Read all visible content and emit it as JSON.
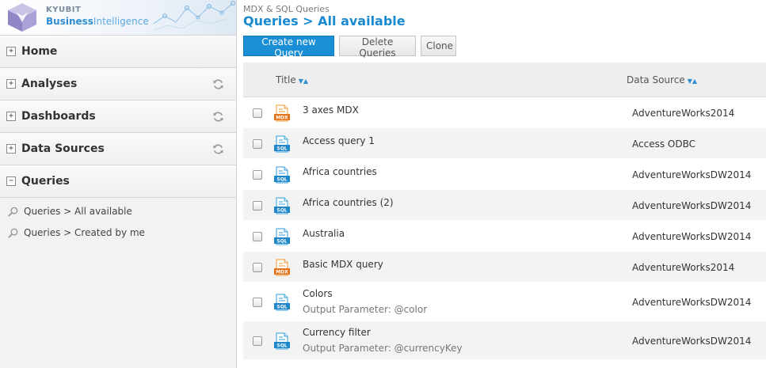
{
  "brand": {
    "top": "KYUBIT",
    "bottom_bold": "Business",
    "bottom_light": "Intelligence"
  },
  "sidebar": {
    "nav": [
      {
        "label": "Home",
        "toggle": "+",
        "refresh": false
      },
      {
        "label": "Analyses",
        "toggle": "+",
        "refresh": true
      },
      {
        "label": "Dashboards",
        "toggle": "+",
        "refresh": true
      },
      {
        "label": "Data Sources",
        "toggle": "+",
        "refresh": true
      },
      {
        "label": "Queries",
        "toggle": "−",
        "refresh": false
      }
    ],
    "sub": [
      {
        "label": "Queries > All available"
      },
      {
        "label": "Queries > Created by me"
      }
    ]
  },
  "main": {
    "breadcrumb": "MDX & SQL Queries",
    "title": "Queries > All available",
    "buttons": {
      "create": "Create new Query",
      "delete": "Delete Queries",
      "clone": "Clone"
    },
    "columns": {
      "title": "Title",
      "datasource": "Data Source",
      "sort_glyph": "▼▲"
    },
    "rows": [
      {
        "type": "MDX",
        "title": "3 axes MDX",
        "param": "",
        "ds": "AdventureWorks2014"
      },
      {
        "type": "SQL",
        "title": "Access query 1",
        "param": "",
        "ds": "Access ODBC"
      },
      {
        "type": "SQL",
        "title": "Africa countries",
        "param": "",
        "ds": "AdventureWorksDW2014"
      },
      {
        "type": "SQL",
        "title": "Africa countries (2)",
        "param": "",
        "ds": "AdventureWorksDW2014"
      },
      {
        "type": "SQL",
        "title": "Australia",
        "param": "",
        "ds": "AdventureWorksDW2014"
      },
      {
        "type": "MDX",
        "title": "Basic MDX query",
        "param": "",
        "ds": "AdventureWorks2014"
      },
      {
        "type": "SQL",
        "title": "Colors",
        "param": "Output Parameter: @color",
        "ds": "AdventureWorksDW2014"
      },
      {
        "type": "SQL",
        "title": "Currency filter",
        "param": "Output Parameter: @currencyKey",
        "ds": "AdventureWorksDW2014"
      }
    ]
  },
  "colors": {
    "accent": "#1a8fd6",
    "mdx": "#f39a2b",
    "sql": "#2f9ede"
  }
}
